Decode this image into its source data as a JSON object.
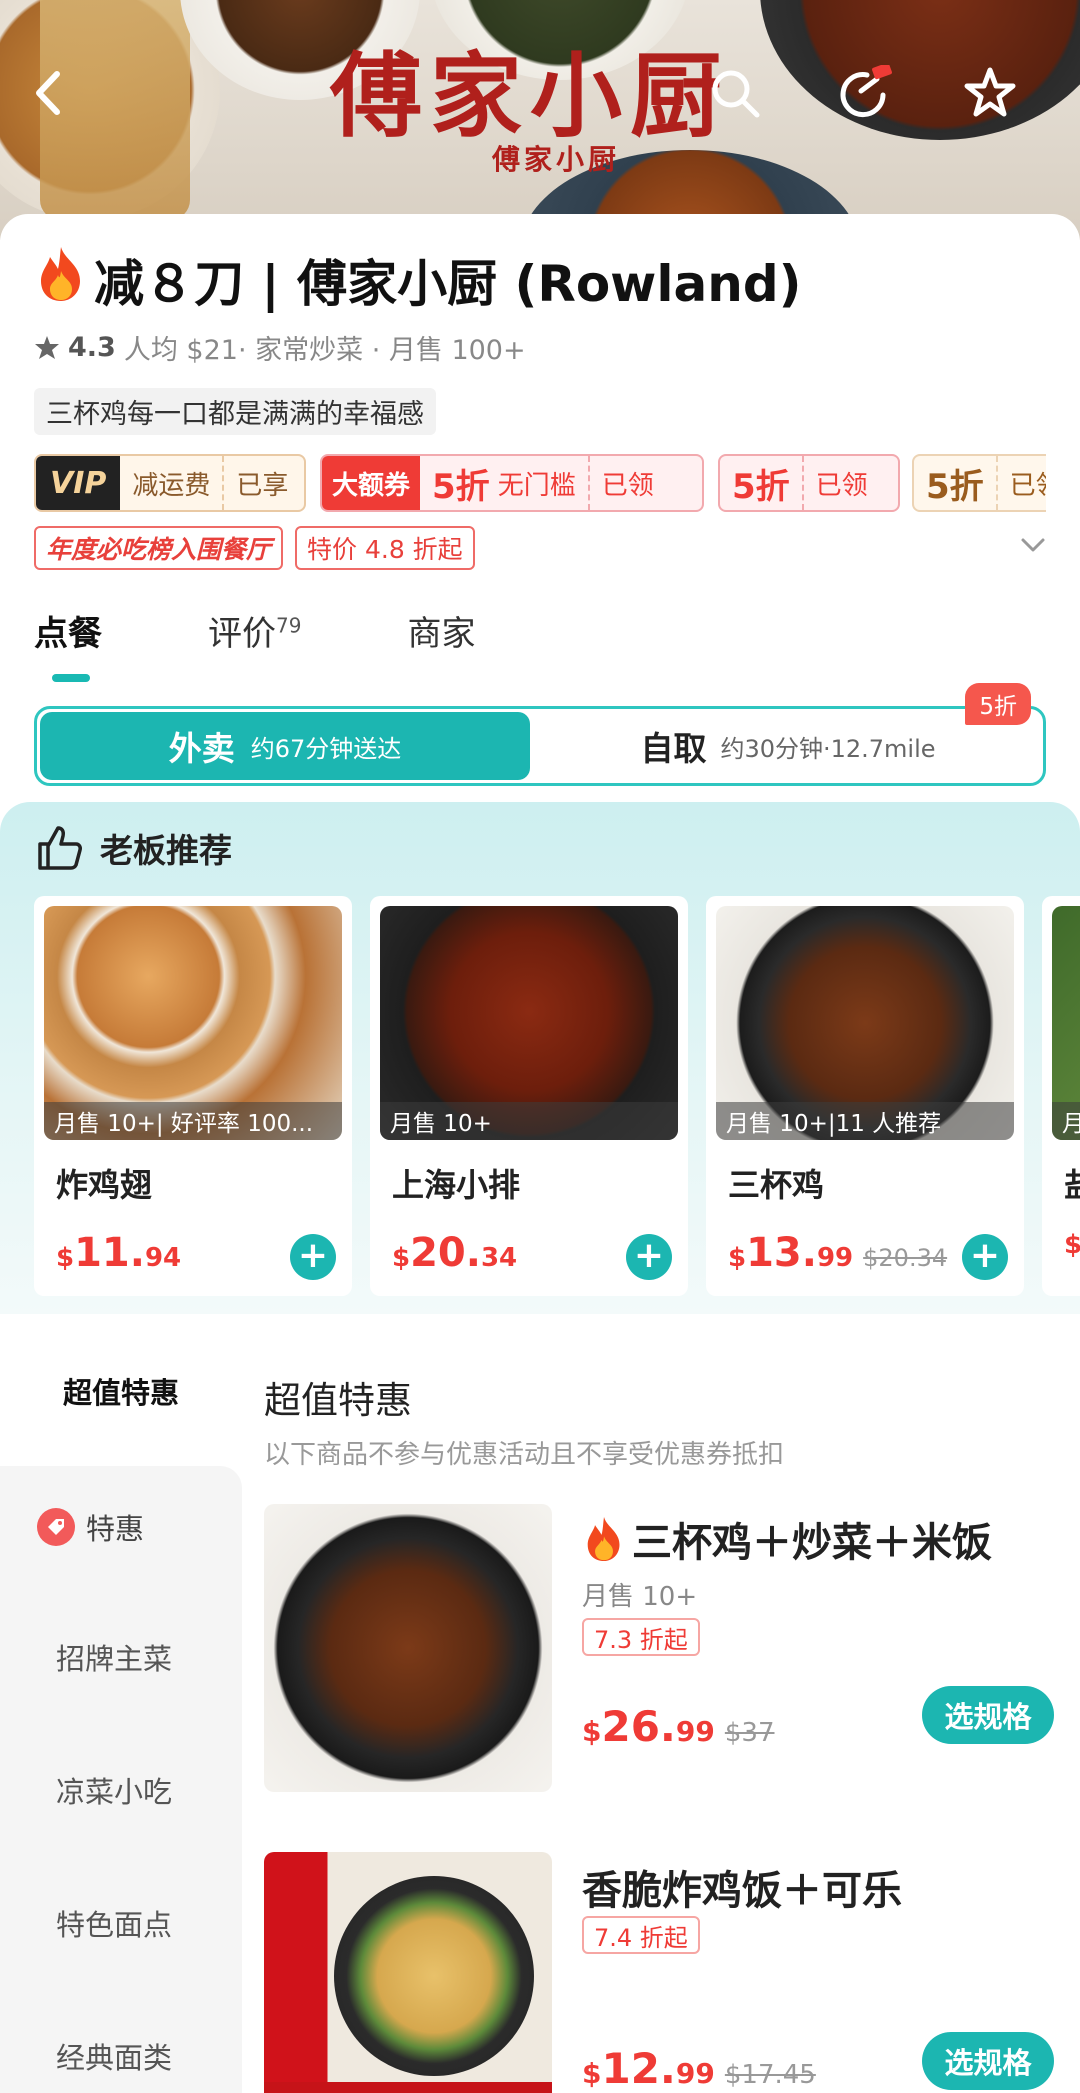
{
  "hero": {
    "logo_text": "傅家小厨",
    "logo_sub": "傅家小厨"
  },
  "store": {
    "name": "减８刀 | 傅家小厨 (Rowland)",
    "rating": "4.3",
    "meta": "人均 $21· 家常炒菜 · 月售 100+",
    "slogan": "三杯鸡每一口都是满满的幸福感"
  },
  "coupons": {
    "vip_badge": "VIP",
    "vip_text": "减运费",
    "vip_status": "已享",
    "big_badge": "大额券",
    "big_discount": "5折",
    "big_text": "无门槛",
    "big_status": "已领",
    "c3_discount": "5折",
    "c3_status": "已领",
    "c4_discount": "5折",
    "c4_status": "已领"
  },
  "tags": [
    "年度必吃榜入围餐厅",
    "特价 4.8 折起"
  ],
  "tabs": {
    "order": "点餐",
    "reviews": "评价",
    "reviews_count": "79",
    "merchant": "商家"
  },
  "mode": {
    "delivery_label": "外卖",
    "delivery_time": "约67分钟送达",
    "pickup_label": "自取",
    "pickup_info": "约30分钟·12.7mile",
    "pickup_badge": "5折"
  },
  "boss": {
    "title": "老板推荐",
    "cards": [
      {
        "sales": "月售 10+| 好评率 100...",
        "name": "炸鸡翅",
        "cur": "$",
        "int": "11.",
        "dec": "94",
        "orig": ""
      },
      {
        "sales": "月售 10+",
        "name": "上海小排",
        "cur": "$",
        "int": "20.",
        "dec": "34",
        "orig": ""
      },
      {
        "sales": "月售 10+|11 人推荐",
        "name": "三杯鸡",
        "cur": "$",
        "int": "13.",
        "dec": "99",
        "orig": "$20.34"
      },
      {
        "sales": "月",
        "name": "盐",
        "cur": "$",
        "int": "",
        "dec": "",
        "orig": ""
      }
    ]
  },
  "menu": {
    "sidebar": {
      "active": "超值特惠",
      "items": [
        "特惠",
        "招牌主菜",
        "凉菜小吃",
        "特色面点",
        "经典面类"
      ]
    },
    "section_title": "超值特惠",
    "section_note": "以下商品不参与优惠活动且不享受优惠券抵扣",
    "items": [
      {
        "title": "三杯鸡＋炒菜＋米饭",
        "sales": "月售 10+",
        "discount": "7.3 折起",
        "cur": "$",
        "int": "26.",
        "dec": "99",
        "orig": "$37",
        "button": "选规格"
      },
      {
        "title": "香脆炸鸡饭＋可乐",
        "sales": "",
        "discount": "7.4 折起",
        "cur": "$",
        "int": "12.",
        "dec": "99",
        "orig": "$17.45",
        "button": "选规格"
      }
    ]
  },
  "colors": {
    "accent": "#1cb6b1",
    "price": "#ef3b36",
    "brand_red": "#b0201c"
  }
}
